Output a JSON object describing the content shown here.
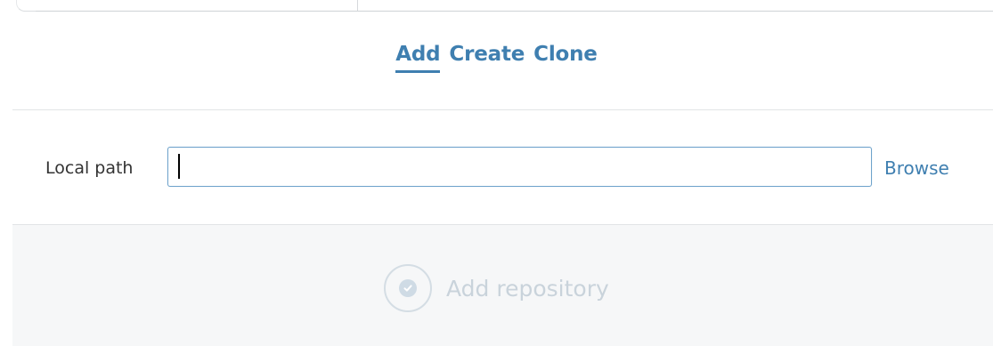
{
  "tabs": {
    "add": "Add",
    "create": "Create",
    "clone": "Clone",
    "active": "Add"
  },
  "local_path": {
    "label": "Local path",
    "value": "",
    "placeholder": "",
    "browse_label": "Browse"
  },
  "footer": {
    "add_repository_label": "Add repository",
    "add_repository_icon": "check-circle-icon",
    "enabled": false
  },
  "colors": {
    "accent": "#3f7fb0",
    "disabled_text": "#c9d3db",
    "footer_bg": "#f6f7f8"
  }
}
